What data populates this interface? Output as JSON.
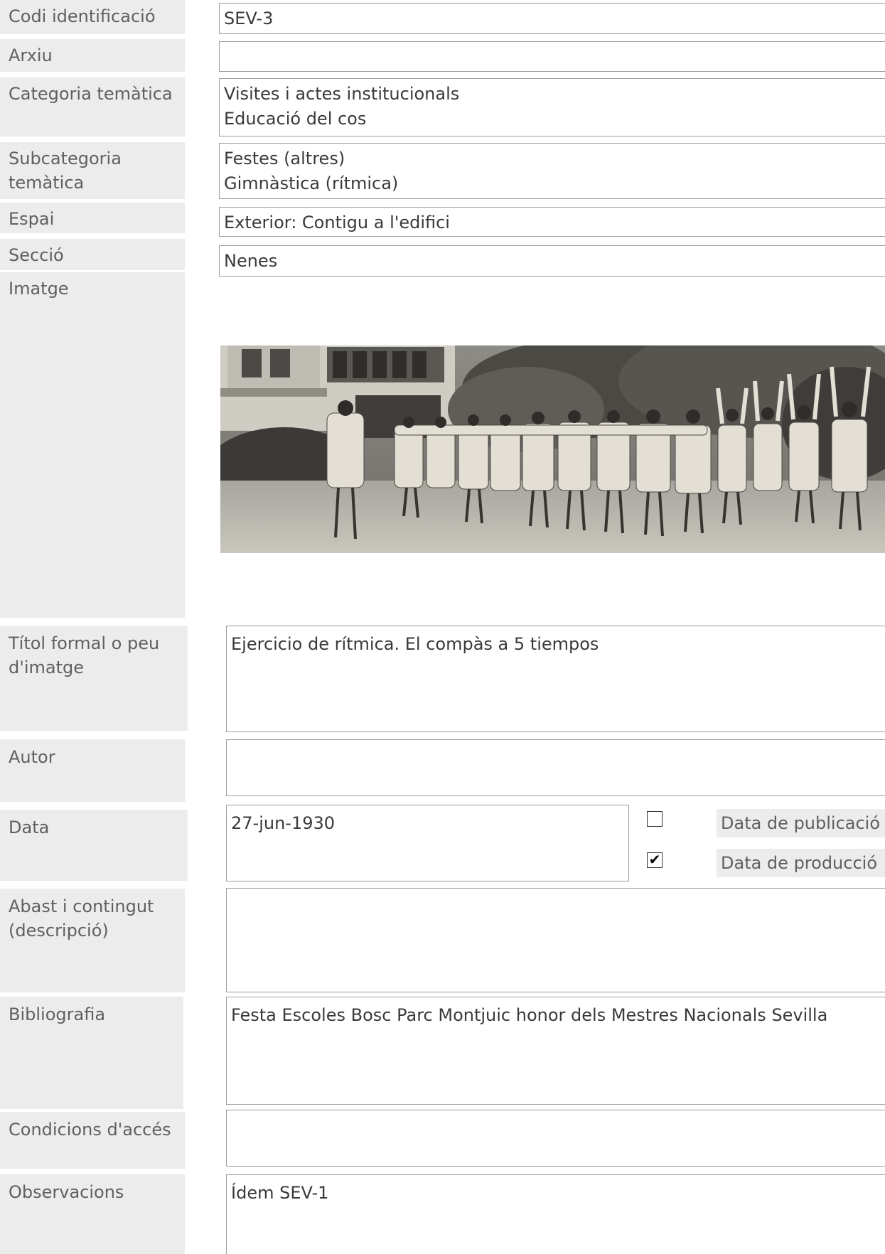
{
  "fields": {
    "codi": {
      "label": "Codi identificació",
      "value": "SEV-3"
    },
    "arxiu": {
      "label": "Arxiu",
      "value": ""
    },
    "categoria": {
      "label": "Categoria temàtica",
      "value": "Visites i actes institucionals\nEducació del cos"
    },
    "subcategoria": {
      "label": "Subcategoria\ntemàtica",
      "value": "Festes (altres)\nGimnàstica (rítmica)"
    },
    "espai": {
      "label": "Espai",
      "value": "Exterior: Contigu a l'edifici"
    },
    "seccio": {
      "label": "Secció",
      "value": "Nenes"
    },
    "imatge": {
      "label": "Imatge"
    },
    "titol": {
      "label": "Títol formal o peu\nd'imatge",
      "value": "Ejercicio de rítmica. El compàs a 5 tiempos"
    },
    "autor": {
      "label": "Autor",
      "value": ""
    },
    "data": {
      "label": "Data",
      "value": "27-jun-1930",
      "options": [
        {
          "label": "Data de publicació",
          "checked": false
        },
        {
          "label": "Data de producció",
          "checked": true
        }
      ]
    },
    "abast": {
      "label": "Abast i contingut\n(descripció)",
      "value": ""
    },
    "bibliografia": {
      "label": "Bibliografia",
      "value": "Festa Escoles Bosc Parc Montjuic honor dels Mestres Nacionals Sevilla"
    },
    "condicions": {
      "label": "Condicions d'accés",
      "value": ""
    },
    "observacions": {
      "label": "Observacions",
      "value": "Ídem SEV-1"
    }
  },
  "colors": {
    "label_bg": "#ececec",
    "border": "#9c9c9c"
  }
}
